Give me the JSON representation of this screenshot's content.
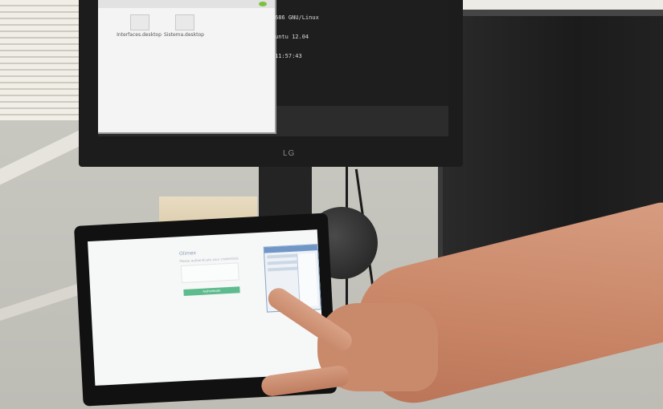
{
  "scene": {
    "monitor": {
      "brand": "LG",
      "desktop_icons": [
        {
          "label": "Interfaces.desktop"
        },
        {
          "label": "Sistema.desktop"
        }
      ],
      "terminal_lines": [
        "686 GNU/Linux",
        "untu 12.04",
        "11:57:43"
      ]
    },
    "tablet": {
      "login_title": "Olimex",
      "login_subtitle": "Please authenticate your credentials",
      "login_button": "Authenticate"
    }
  }
}
